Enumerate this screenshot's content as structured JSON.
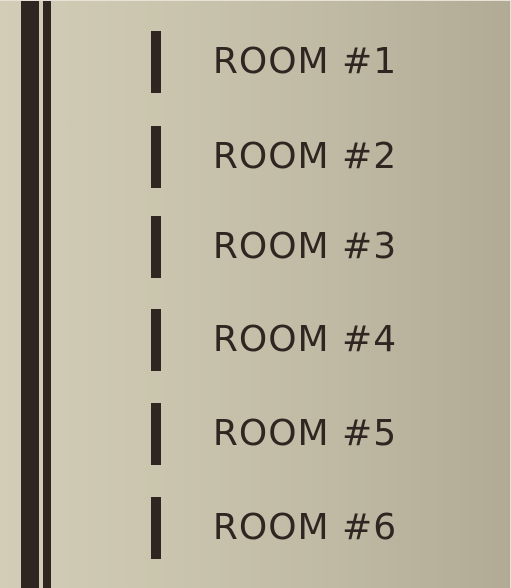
{
  "sign": {
    "rooms": [
      {
        "label": "ROOM #1"
      },
      {
        "label": "ROOM #2"
      },
      {
        "label": "ROOM #3"
      },
      {
        "label": "ROOM #4"
      },
      {
        "label": "ROOM #5"
      },
      {
        "label": "ROOM #6"
      }
    ],
    "colors": {
      "panel": "#c9c4ad",
      "ink": "#2f2622"
    }
  }
}
